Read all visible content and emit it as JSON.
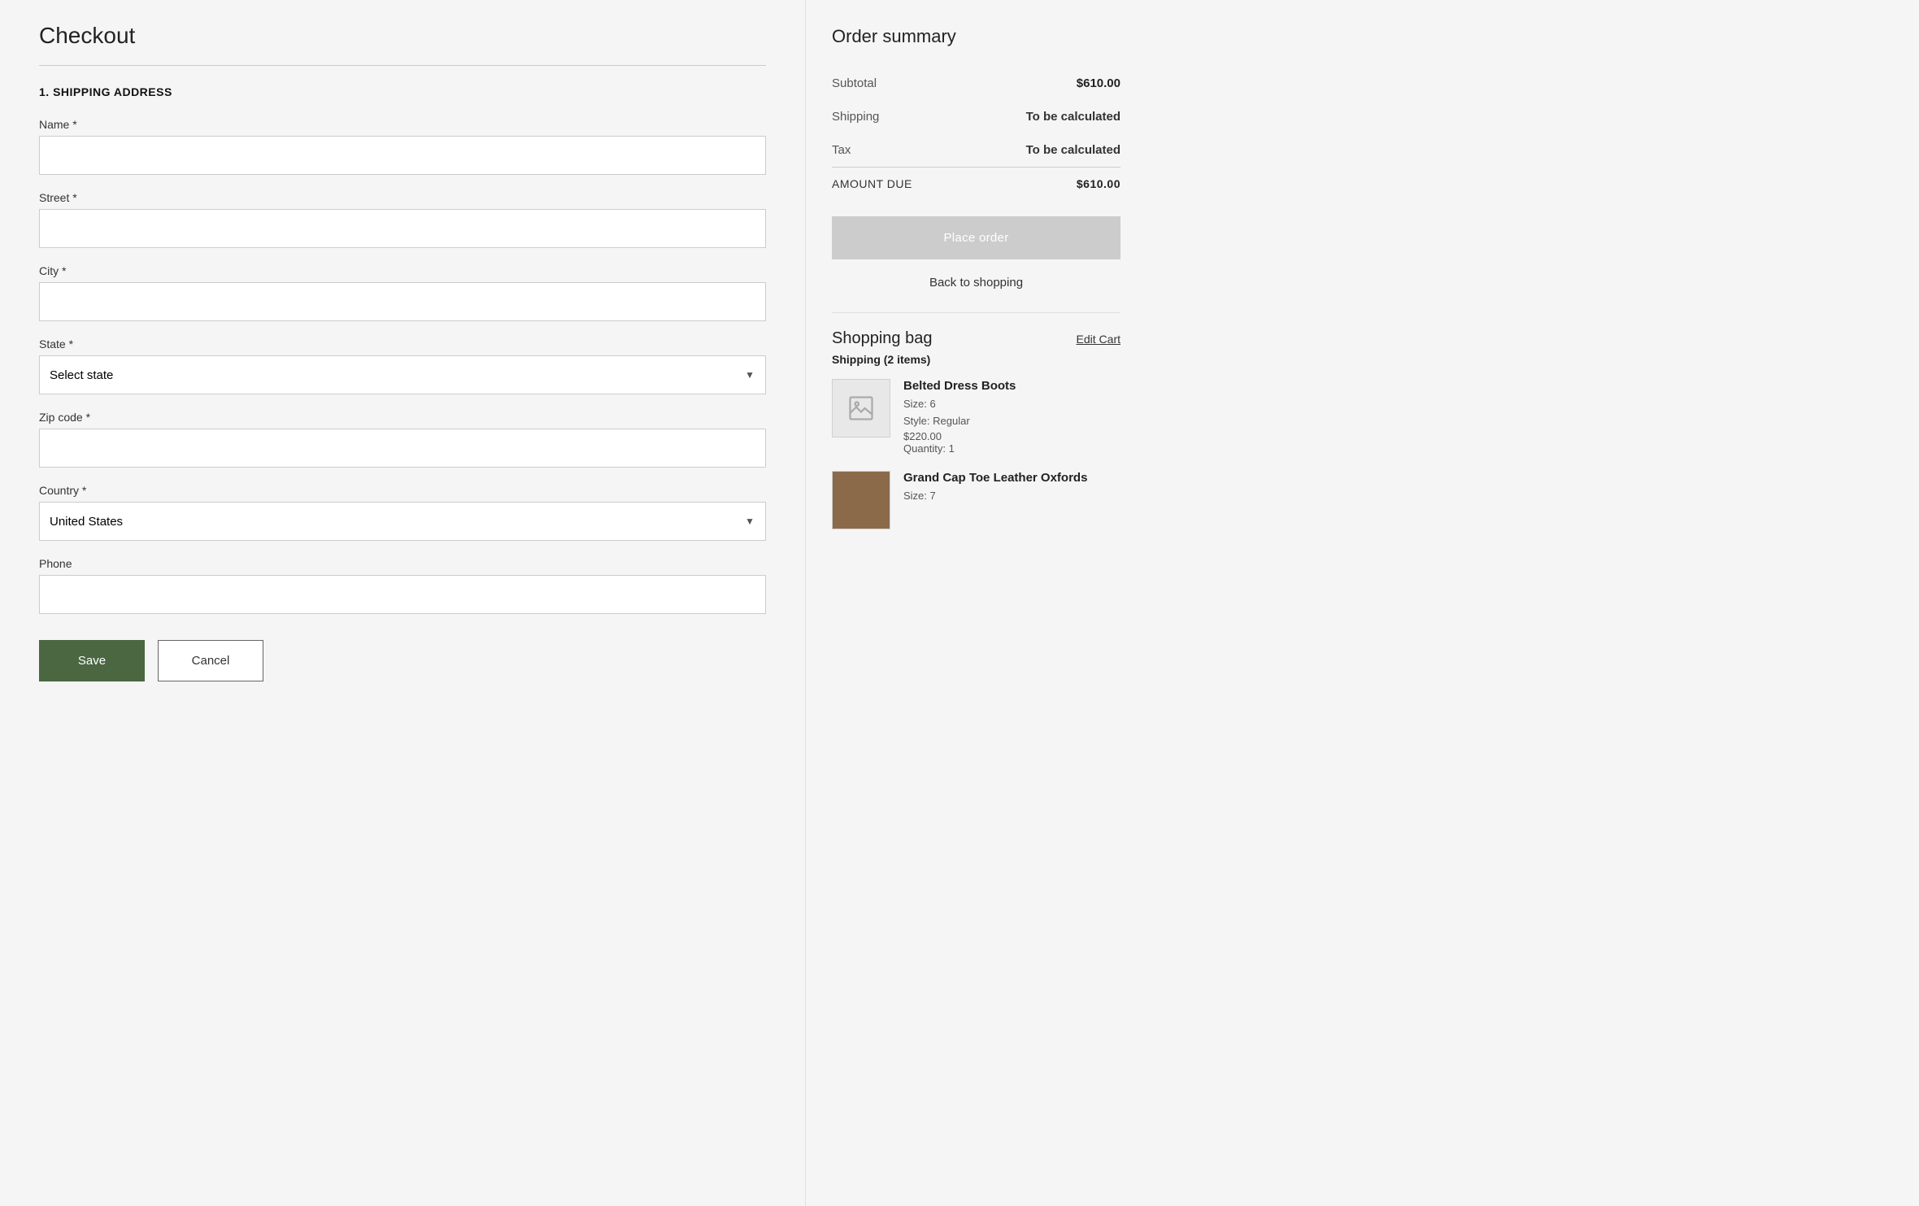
{
  "page": {
    "title": "Checkout"
  },
  "shipping_section": {
    "section_number": "1.",
    "section_title": "SHIPPING ADDRESS",
    "fields": {
      "name": {
        "label": "Name *",
        "value": "",
        "placeholder": ""
      },
      "street": {
        "label": "Street *",
        "value": "",
        "placeholder": ""
      },
      "city": {
        "label": "City *",
        "value": "",
        "placeholder": ""
      },
      "state": {
        "label": "State *",
        "placeholder": "Select state",
        "value": ""
      },
      "zip": {
        "label": "Zip code *",
        "value": "",
        "placeholder": ""
      },
      "country": {
        "label": "Country *",
        "value": "United States"
      },
      "phone": {
        "label": "Phone",
        "value": "",
        "placeholder": ""
      }
    },
    "buttons": {
      "save": "Save",
      "cancel": "Cancel"
    }
  },
  "order_summary": {
    "title": "Order summary",
    "rows": [
      {
        "label": "Subtotal",
        "value": "$610.00",
        "type": "normal"
      },
      {
        "label": "Shipping",
        "value": "To be calculated",
        "type": "calc"
      },
      {
        "label": "Tax",
        "value": "To be calculated",
        "type": "calc"
      },
      {
        "label": "AMOUNT DUE",
        "value": "$610.00",
        "type": "total"
      }
    ],
    "place_order_button": "Place order",
    "back_to_shopping": "Back to shopping"
  },
  "shopping_bag": {
    "title": "Shopping bag",
    "edit_cart_label": "Edit Cart",
    "shipping_label": "Shipping (2 items)",
    "products": [
      {
        "name": "Belted Dress Boots",
        "size": "Size: 6",
        "style": "Style: Regular",
        "price": "$220.00",
        "quantity": "Quantity: 1",
        "has_image": false
      },
      {
        "name": "Grand Cap Toe Leather Oxfords",
        "size": "Size: 7",
        "style": "",
        "price": "",
        "quantity": "",
        "has_image": true
      }
    ]
  },
  "select_arrow": "▼"
}
